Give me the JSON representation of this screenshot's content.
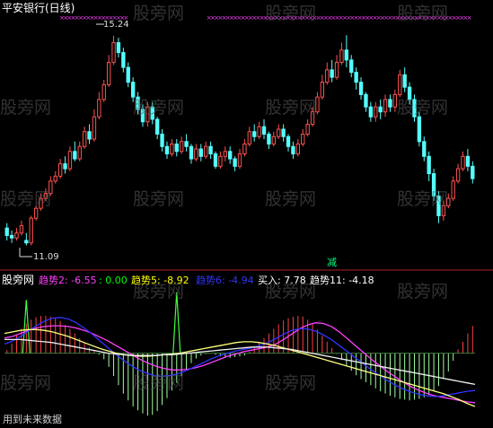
{
  "window": {
    "title": "平安银行(日线)",
    "watermark": "股旁网",
    "indicator_name": "股旁网",
    "footer_note": "用到未来数据",
    "sell_marker": "减"
  },
  "price": {
    "high_label": "15.24",
    "low_label": "11.09",
    "ymin": 10.7,
    "ymax": 15.6
  },
  "indicator": {
    "ymin": -9,
    "ymax": 7.5,
    "items": [
      {
        "label": "趋势2: -6.55",
        "color": "#ff40ff"
      },
      {
        "label": ": 0.00",
        "color": "#00ff00"
      },
      {
        "label": "趋势5: -8.92",
        "color": "#ffff00"
      },
      {
        "label": "趋势6: -4.94",
        "color": "#3333ff"
      },
      {
        "label": "买入: 7.78",
        "color": "#ffffff"
      },
      {
        "label": "趋势11: -4.18",
        "color": "#ffffff"
      }
    ]
  },
  "colors": {
    "up": "#ff5050",
    "down": "#54ffff",
    "signal": "#ff40ff",
    "pos_bar": "#ff4040",
    "neg_bar": "#a0ffa0",
    "title": "#ffffff"
  },
  "candles": [
    [
      11.35,
      11.2,
      11.45,
      11.1
    ],
    [
      11.2,
      11.15,
      11.3,
      11.05
    ],
    [
      11.15,
      11.25,
      11.35,
      11.1
    ],
    [
      11.25,
      11.4,
      11.5,
      11.2
    ],
    [
      11.1,
      11.05,
      11.25,
      11.0
    ],
    [
      11.05,
      11.55,
      11.6,
      11.0
    ],
    [
      11.55,
      11.75,
      11.8,
      11.5
    ],
    [
      11.75,
      11.95,
      12.05,
      11.7
    ],
    [
      11.95,
      12.05,
      12.15,
      11.9
    ],
    [
      12.05,
      12.3,
      12.4,
      12.0
    ],
    [
      12.3,
      12.4,
      12.5,
      12.25
    ],
    [
      12.4,
      12.65,
      12.75,
      12.35
    ],
    [
      12.65,
      12.55,
      12.8,
      12.45
    ],
    [
      12.55,
      12.9,
      13.0,
      12.5
    ],
    [
      12.9,
      12.75,
      13.1,
      12.7
    ],
    [
      12.75,
      13.0,
      13.1,
      12.7
    ],
    [
      13.0,
      13.3,
      13.4,
      12.95
    ],
    [
      13.3,
      13.15,
      13.45,
      13.05
    ],
    [
      13.15,
      13.6,
      13.75,
      13.1
    ],
    [
      13.6,
      13.95,
      14.1,
      13.55
    ],
    [
      13.95,
      14.25,
      14.35,
      13.9
    ],
    [
      14.25,
      14.7,
      14.85,
      14.2
    ],
    [
      14.7,
      15.1,
      15.24,
      14.65
    ],
    [
      15.1,
      14.9,
      15.2,
      14.8
    ],
    [
      14.9,
      14.6,
      15.0,
      14.5
    ],
    [
      14.6,
      14.3,
      14.7,
      14.2
    ],
    [
      14.3,
      14.0,
      14.4,
      13.9
    ],
    [
      14.0,
      13.75,
      14.1,
      13.65
    ],
    [
      13.75,
      13.5,
      13.85,
      13.4
    ],
    [
      13.5,
      13.8,
      13.9,
      13.4
    ],
    [
      13.8,
      13.55,
      13.9,
      13.45
    ],
    [
      13.55,
      13.25,
      13.6,
      13.15
    ],
    [
      13.25,
      13.0,
      13.35,
      12.9
    ],
    [
      13.0,
      12.85,
      13.1,
      12.75
    ],
    [
      12.85,
      13.05,
      13.15,
      12.8
    ],
    [
      13.05,
      12.9,
      13.15,
      12.8
    ],
    [
      12.9,
      13.1,
      13.2,
      12.85
    ],
    [
      13.1,
      13.0,
      13.25,
      12.9
    ],
    [
      13.0,
      12.75,
      13.05,
      12.65
    ],
    [
      12.75,
      12.95,
      13.05,
      12.7
    ],
    [
      12.95,
      12.8,
      13.05,
      12.7
    ],
    [
      12.8,
      13.0,
      13.1,
      12.75
    ],
    [
      13.0,
      12.85,
      13.1,
      12.75
    ],
    [
      12.85,
      12.6,
      12.9,
      12.55
    ],
    [
      12.6,
      12.8,
      12.9,
      12.55
    ],
    [
      12.8,
      12.9,
      13.0,
      12.7
    ],
    [
      12.9,
      12.75,
      13.0,
      12.65
    ],
    [
      12.75,
      12.6,
      12.8,
      12.5
    ],
    [
      12.6,
      12.85,
      12.95,
      12.55
    ],
    [
      12.85,
      13.05,
      13.15,
      12.8
    ],
    [
      13.05,
      13.3,
      13.4,
      13.0
    ],
    [
      13.3,
      13.2,
      13.45,
      13.1
    ],
    [
      13.2,
      13.4,
      13.5,
      13.15
    ],
    [
      13.4,
      13.25,
      13.55,
      13.15
    ],
    [
      13.25,
      13.05,
      13.3,
      12.95
    ],
    [
      13.05,
      13.2,
      13.3,
      13.0
    ],
    [
      13.2,
      13.35,
      13.45,
      13.15
    ],
    [
      13.35,
      13.2,
      13.45,
      13.1
    ],
    [
      13.2,
      13.0,
      13.25,
      12.9
    ],
    [
      13.0,
      12.85,
      13.1,
      12.75
    ],
    [
      12.85,
      13.05,
      13.15,
      12.8
    ],
    [
      13.05,
      13.25,
      13.35,
      13.0
    ],
    [
      13.25,
      13.45,
      13.55,
      13.2
    ],
    [
      13.45,
      13.7,
      13.8,
      13.4
    ],
    [
      13.7,
      14.0,
      14.1,
      13.65
    ],
    [
      14.0,
      14.3,
      14.45,
      13.95
    ],
    [
      14.3,
      14.55,
      14.7,
      14.25
    ],
    [
      14.55,
      14.4,
      14.75,
      14.3
    ],
    [
      14.4,
      14.7,
      14.85,
      14.35
    ],
    [
      14.7,
      14.95,
      15.1,
      14.65
    ],
    [
      14.95,
      14.75,
      15.25,
      14.6
    ],
    [
      14.75,
      14.5,
      14.85,
      14.4
    ],
    [
      14.5,
      14.3,
      14.6,
      14.15
    ],
    [
      14.3,
      14.05,
      14.4,
      13.95
    ],
    [
      14.05,
      13.8,
      14.1,
      13.7
    ],
    [
      13.8,
      13.6,
      13.9,
      13.5
    ],
    [
      13.6,
      13.8,
      13.9,
      13.5
    ],
    [
      13.8,
      13.7,
      13.95,
      13.55
    ],
    [
      13.7,
      13.95,
      14.05,
      13.6
    ],
    [
      13.95,
      13.8,
      14.05,
      13.7
    ],
    [
      13.8,
      14.05,
      14.15,
      13.7
    ],
    [
      14.05,
      14.45,
      14.55,
      14.0
    ],
    [
      14.45,
      14.2,
      14.6,
      14.1
    ],
    [
      14.2,
      13.95,
      14.3,
      13.85
    ],
    [
      13.95,
      13.6,
      14.05,
      13.5
    ],
    [
      13.6,
      13.1,
      13.7,
      13.0
    ],
    [
      13.1,
      12.8,
      13.2,
      12.7
    ],
    [
      12.8,
      12.45,
      12.9,
      12.3
    ],
    [
      12.45,
      12.0,
      12.55,
      11.9
    ],
    [
      12.0,
      11.6,
      12.1,
      11.45
    ],
    [
      11.6,
      11.8,
      11.9,
      11.5
    ],
    [
      11.8,
      11.95,
      12.05,
      11.75
    ],
    [
      11.95,
      12.3,
      12.4,
      11.9
    ],
    [
      12.3,
      12.55,
      12.65,
      12.25
    ],
    [
      12.55,
      12.8,
      12.9,
      12.5
    ],
    [
      12.8,
      12.6,
      12.95,
      12.5
    ],
    [
      12.6,
      12.35,
      12.7,
      12.25
    ]
  ],
  "hist": [
    0.4,
    1.3,
    2.4,
    3.2,
    3.9,
    4.4,
    4.7,
    4.9,
    4.9,
    4.8,
    4.6,
    4.2,
    3.7,
    3.2,
    2.6,
    2.0,
    1.4,
    0.8,
    0.3,
    -0.2,
    -0.8,
    -1.8,
    -3.0,
    -4.2,
    -5.3,
    -6.2,
    -7.0,
    -7.5,
    -7.9,
    -8.2,
    -8.1,
    -7.6,
    -6.8,
    -5.9,
    -4.9,
    -3.9,
    -3.0,
    -2.1,
    -1.3,
    -0.7,
    -0.3,
    -0.1,
    0.0,
    -0.2,
    -0.4,
    -0.5,
    -0.6,
    -0.5,
    -0.4,
    -0.3,
    0.2,
    0.8,
    1.4,
    2.0,
    2.6,
    3.2,
    3.8,
    4.3,
    4.6,
    4.8,
    4.9,
    4.8,
    4.4,
    3.8,
    3.1,
    2.3,
    1.5,
    0.7,
    -0.1,
    -0.9,
    -1.6,
    -2.3,
    -2.9,
    -3.4,
    -3.8,
    -4.2,
    -4.6,
    -5.0,
    -5.3,
    -5.6,
    -5.8,
    -6.0,
    -6.1,
    -6.2,
    -6.1,
    -6.0,
    -5.8,
    -5.5,
    -5.0,
    -4.3,
    -3.4,
    -2.4,
    -1.0,
    0.5,
    1.5,
    2.6,
    3.6
  ],
  "spikes": [
    {
      "index": 4,
      "value": 7.0
    },
    {
      "index": 35,
      "value": 8.0
    }
  ],
  "lines": {
    "magenta": [
      2.0,
      2.2,
      2.6,
      3.0,
      3.3,
      3.5,
      3.6,
      3.6,
      3.5,
      3.3,
      3.0,
      2.6,
      2.1,
      1.6,
      1.0,
      0.4,
      -0.2,
      -0.8,
      -1.3,
      -1.7,
      -2.0,
      -2.2,
      -2.2,
      -2.1,
      -1.9,
      -1.6,
      -1.2,
      -0.8,
      -0.4,
      -0.1,
      0.2,
      0.4,
      0.6,
      0.8,
      1.2,
      1.8,
      2.5,
      3.2,
      3.7,
      4.0,
      3.9,
      3.5,
      2.8,
      1.9,
      1.0,
      0.1,
      -0.8,
      -1.6,
      -2.4,
      -3.1,
      -3.8,
      -4.4,
      -4.9,
      -5.3,
      -5.6,
      -5.8,
      -6.0,
      -6.2,
      -6.4,
      -6.5
    ],
    "blue": [
      1.2,
      1.6,
      2.2,
      2.9,
      3.6,
      4.2,
      4.6,
      4.7,
      4.5,
      4.0,
      3.3,
      2.5,
      1.6,
      0.7,
      -0.2,
      -1.0,
      -1.7,
      -2.3,
      -2.7,
      -3.0,
      -3.0,
      -2.9,
      -2.6,
      -2.2,
      -1.7,
      -1.2,
      -0.7,
      -0.3,
      0.0,
      0.3,
      0.5,
      0.7,
      1.0,
      1.4,
      1.9,
      2.5,
      3.0,
      3.2,
      3.2,
      2.9,
      2.4,
      1.8,
      1.0,
      0.2,
      -0.6,
      -1.4,
      -2.2,
      -2.9,
      -3.6,
      -4.2,
      -4.7,
      -5.1,
      -5.4,
      -5.6,
      -5.7,
      -5.6,
      -5.4,
      -5.2,
      -5.0,
      -4.9
    ],
    "yellow": [
      2.6,
      2.8,
      3.0,
      3.1,
      3.1,
      3.0,
      2.8,
      2.5,
      2.2,
      1.8,
      1.4,
      1.0,
      0.6,
      0.3,
      0.0,
      -0.2,
      -0.3,
      -0.4,
      -0.4,
      -0.3,
      -0.2,
      -0.1,
      0.0,
      0.2,
      0.4,
      0.6,
      0.8,
      1.0,
      1.2,
      1.4,
      1.5,
      1.5,
      1.4,
      1.2,
      1.0,
      0.7,
      0.4,
      0.1,
      -0.2,
      -0.5,
      -0.8,
      -1.1,
      -1.4,
      -1.7,
      -2.0,
      -2.3,
      -2.6,
      -2.9,
      -3.2,
      -3.5,
      -3.8,
      -4.1,
      -4.4,
      -4.7,
      -5.0,
      -5.3,
      -5.7,
      -6.1,
      -6.6,
      -7.0
    ],
    "white": [
      1.8,
      1.8,
      1.8,
      1.7,
      1.6,
      1.5,
      1.4,
      1.2,
      1.0,
      0.8,
      0.6,
      0.4,
      0.2,
      0.0,
      -0.1,
      -0.2,
      -0.3,
      -0.3,
      -0.3,
      -0.3,
      -0.2,
      -0.2,
      -0.1,
      0.0,
      0.1,
      0.2,
      0.3,
      0.4,
      0.5,
      0.6,
      0.7,
      0.8,
      0.8,
      0.8,
      0.7,
      0.6,
      0.5,
      0.3,
      0.1,
      -0.1,
      -0.3,
      -0.5,
      -0.7,
      -0.9,
      -1.1,
      -1.3,
      -1.5,
      -1.7,
      -1.9,
      -2.1,
      -2.3,
      -2.5,
      -2.7,
      -2.9,
      -3.1,
      -3.3,
      -3.5,
      -3.7,
      -3.9,
      -4.1
    ]
  }
}
